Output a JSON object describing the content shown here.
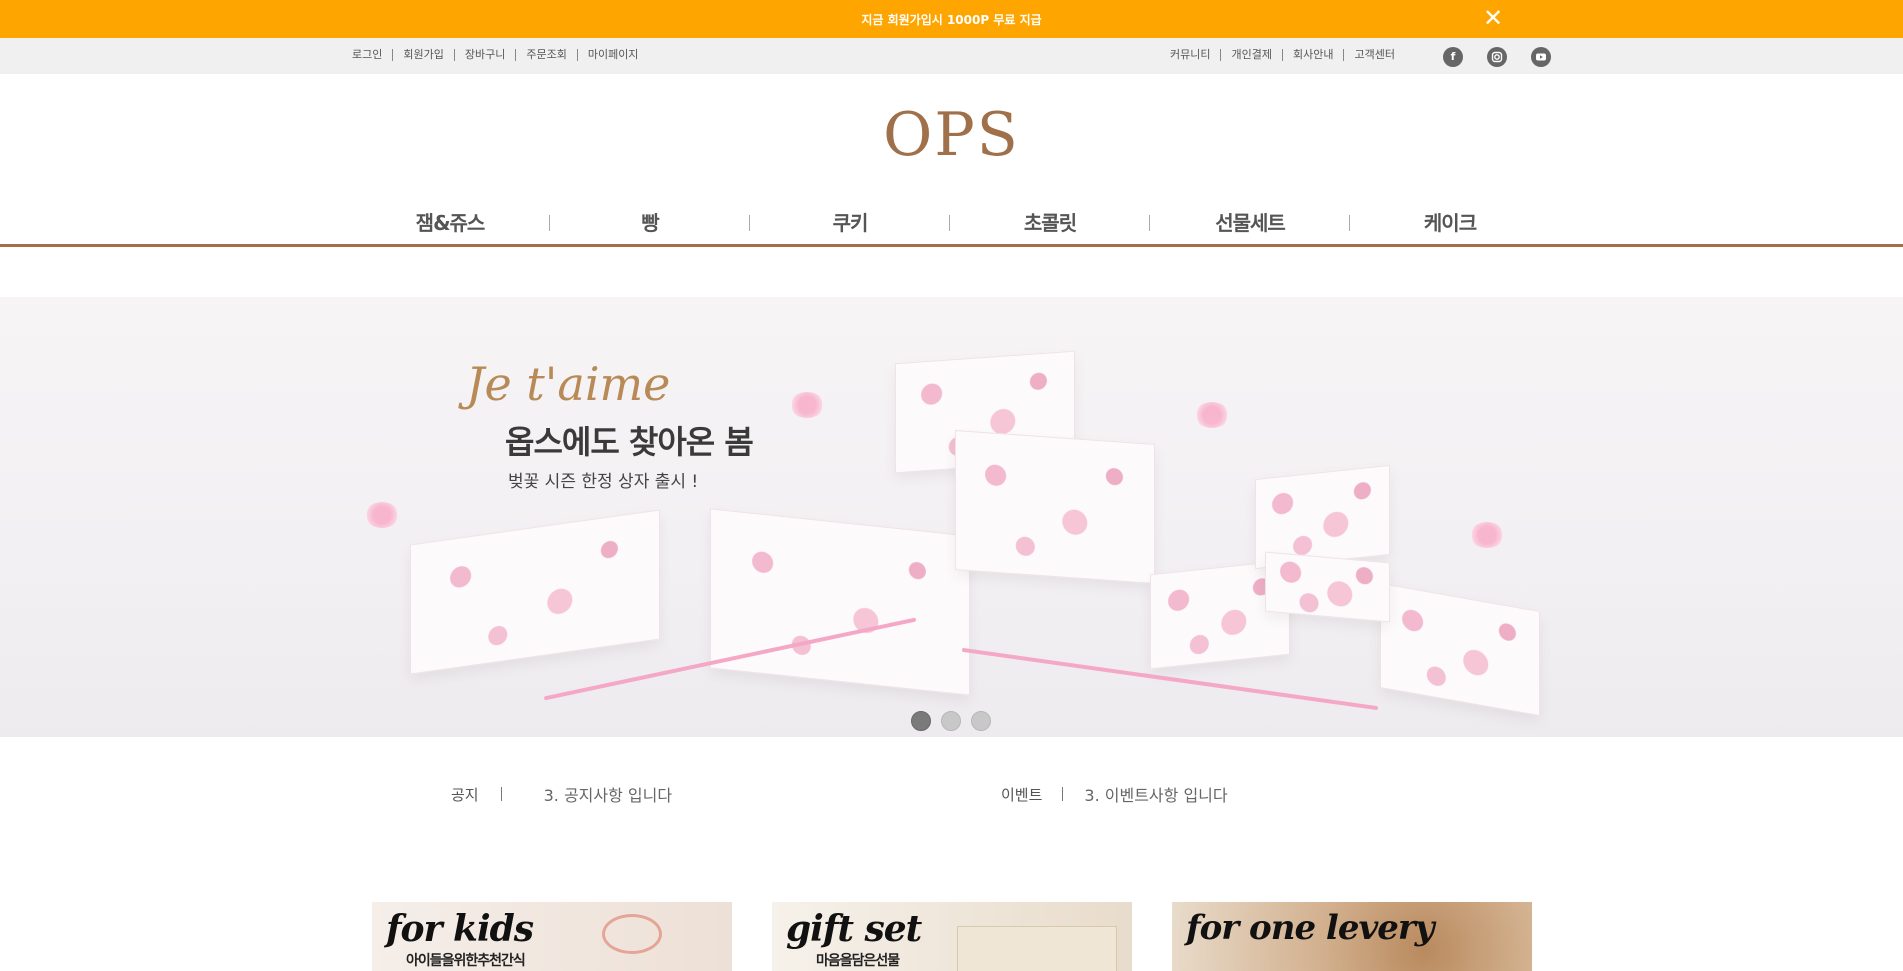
{
  "promo": {
    "text": "지금 회원가입시 1000P 무료 지급",
    "close_icon": "close-icon"
  },
  "util": {
    "left_links": [
      "로그인",
      "회원가입",
      "장바구니",
      "주문조회",
      "마이페이지"
    ],
    "right_links": [
      "커뮤니티",
      "개인결제",
      "회사안내",
      "고객센터"
    ],
    "social_icons": [
      "facebook-icon",
      "instagram-icon",
      "youtube-icon"
    ]
  },
  "logo": "OPS",
  "nav": {
    "items": [
      "잼&쥬스",
      "빵",
      "쿠키",
      "초콜릿",
      "선물세트",
      "케이크"
    ]
  },
  "hero": {
    "script": "Je t'aime",
    "title": "옵스에도 찾아온 봄",
    "subtitle": "벚꽃 시즌 한정 상자 출시 !",
    "slide_count": 3,
    "active_slide": 1
  },
  "notices": [
    {
      "label": "공지",
      "text": "3. 공지사항 입니다"
    },
    {
      "label": "이벤트",
      "text": "3. 이벤트사항 입니다"
    }
  ],
  "cards": [
    {
      "title": "for kids",
      "subtitle": "아이들을위한추천간식",
      "bg": "#f4ece6"
    },
    {
      "title": "gift set",
      "subtitle": "마음을담은선물",
      "bg": "#f1ebe2"
    },
    {
      "title": "for one levery",
      "subtitle": "",
      "bg": "#d9c2a8"
    }
  ],
  "colors": {
    "promo": "#ffa500",
    "brand": "#a0704a"
  }
}
